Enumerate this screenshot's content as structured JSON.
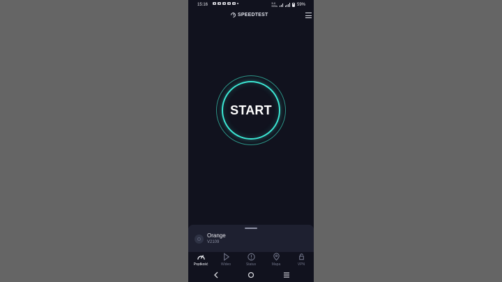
{
  "status_bar": {
    "time": "15:16",
    "network_top": "5.0",
    "network_bottom": "KB/s",
    "battery": "59%"
  },
  "header": {
    "title": "SPEEDTEST",
    "menu_icon": "hamburger-icon"
  },
  "start_button": {
    "label": "START"
  },
  "provider": {
    "name": "Orange",
    "server": "V2109",
    "icon": "provider-icon"
  },
  "tabs": [
    {
      "label": "Prędkość",
      "icon": "gauge-icon",
      "active": true
    },
    {
      "label": "Wideo",
      "icon": "play-icon",
      "active": false
    },
    {
      "label": "Status",
      "icon": "alert-icon",
      "active": false
    },
    {
      "label": "Mapa",
      "icon": "map-pin-icon",
      "active": false
    },
    {
      "label": "VPN",
      "icon": "lock-icon",
      "active": false
    }
  ],
  "colors": {
    "background": "#656565",
    "phone_bg": "#11121e",
    "sheet_bg": "#1e2030",
    "accent": "#3ce7d4",
    "text_primary": "#f2f3f8",
    "text_muted": "#707488"
  }
}
